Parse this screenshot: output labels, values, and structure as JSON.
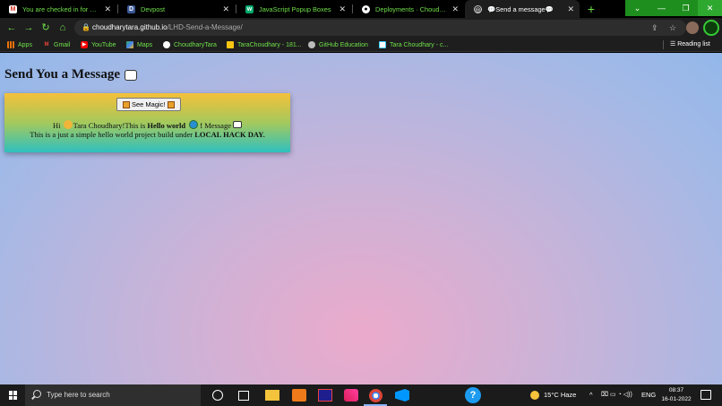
{
  "browser": {
    "tabs": [
      {
        "title": "You are checked in for Today",
        "icon": "gmail-icon",
        "close": "✕"
      },
      {
        "title": "Devpost",
        "icon": "devpost-icon",
        "close": "✕"
      },
      {
        "title": "JavaScript Popup Boxes",
        "icon": "w3schools-icon",
        "close": "✕"
      },
      {
        "title": "Deployments · ChoudharyTa",
        "icon": "github-icon",
        "close": "✕"
      },
      {
        "title": "💬Send a message💬",
        "icon": "globe-icon",
        "close": "✕"
      }
    ],
    "new_tab": "+",
    "window_controls": [
      "⌄",
      "—",
      "❐",
      "✕"
    ],
    "url_host": "choudharytara.github.io",
    "url_path": "/LHD-Send-a-Message/",
    "bookmarks": [
      {
        "label": "Apps",
        "icon": "apps-grid-icon"
      },
      {
        "label": "Gmail",
        "icon": "gmail-icon"
      },
      {
        "label": "YouTube",
        "icon": "youtube-icon"
      },
      {
        "label": "Maps",
        "icon": "maps-icon"
      },
      {
        "label": "ChoudharyTara",
        "icon": "github-icon"
      },
      {
        "label": "TaraChoudhary - 181...",
        "icon": "folder-icon"
      },
      {
        "label": "GitHub Education",
        "icon": "github-icon"
      },
      {
        "label": "Tara Choudhary - c...",
        "icon": "profile-icon"
      }
    ],
    "reading_list": "Reading list"
  },
  "page": {
    "heading": "Send You a Message",
    "button_label": "See Magic!",
    "line1_hi": "Hi",
    "line1_name": "Tara Choudhary!This is",
    "line1_bold": "Hello world",
    "line1_bang": "!",
    "line1_end": "Message",
    "line2_text": "This is a just a simple hello world project build under",
    "line2_bold": "LOCAL HACK DAY."
  },
  "taskbar": {
    "search_placeholder": "Type here to search",
    "weather": "15°C  Haze",
    "language": "ENG",
    "time": "08:37",
    "date": "16-01-2022"
  },
  "colors": {
    "accent_green": "#6fe04a",
    "card_top": "#f4c03a",
    "card_bottom": "#2ec0c0",
    "bg_pink": "#ebaacb",
    "bg_blue": "#93b7ea"
  }
}
